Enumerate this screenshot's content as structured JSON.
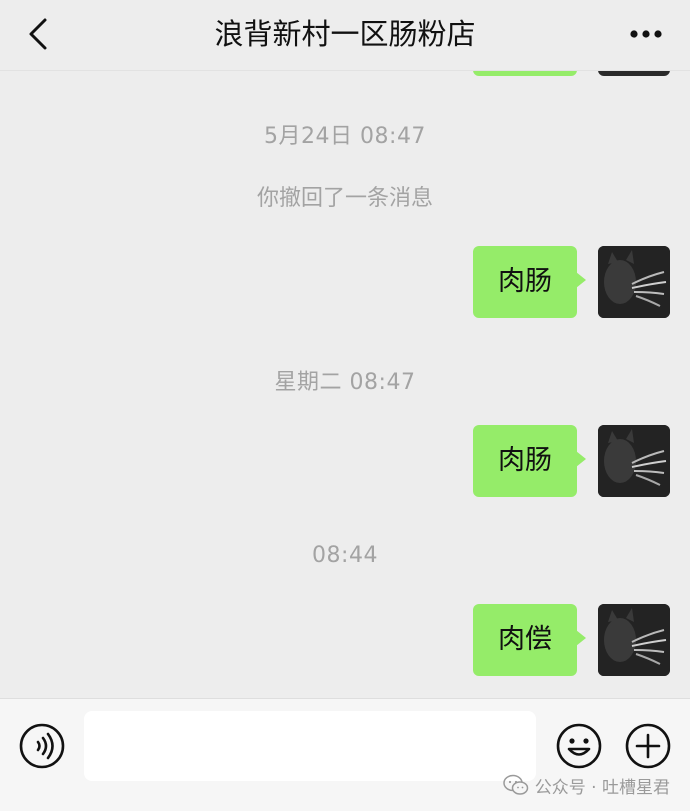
{
  "header": {
    "title": "浪背新村一区肠粉店",
    "back_icon": "chevron-left-icon",
    "more_icon": "ellipsis-icon"
  },
  "messages": {
    "ts1": "5月24日 08:47",
    "recall_notice": "你撤回了一条消息",
    "msg1": "肉肠",
    "ts2": "星期二 08:47",
    "msg2": "肉肠",
    "ts3": "08:44",
    "msg3": "肉偿"
  },
  "input_bar": {
    "voice_icon": "voice-icon",
    "text_value": "",
    "emoji_icon": "smile-icon",
    "plus_icon": "plus-circle-icon"
  },
  "watermark": {
    "text": "公众号 · 吐槽星君"
  },
  "colors": {
    "background": "#ededed",
    "bubble_green": "#95ec69",
    "timestamp_gray": "#a3a3a3"
  }
}
